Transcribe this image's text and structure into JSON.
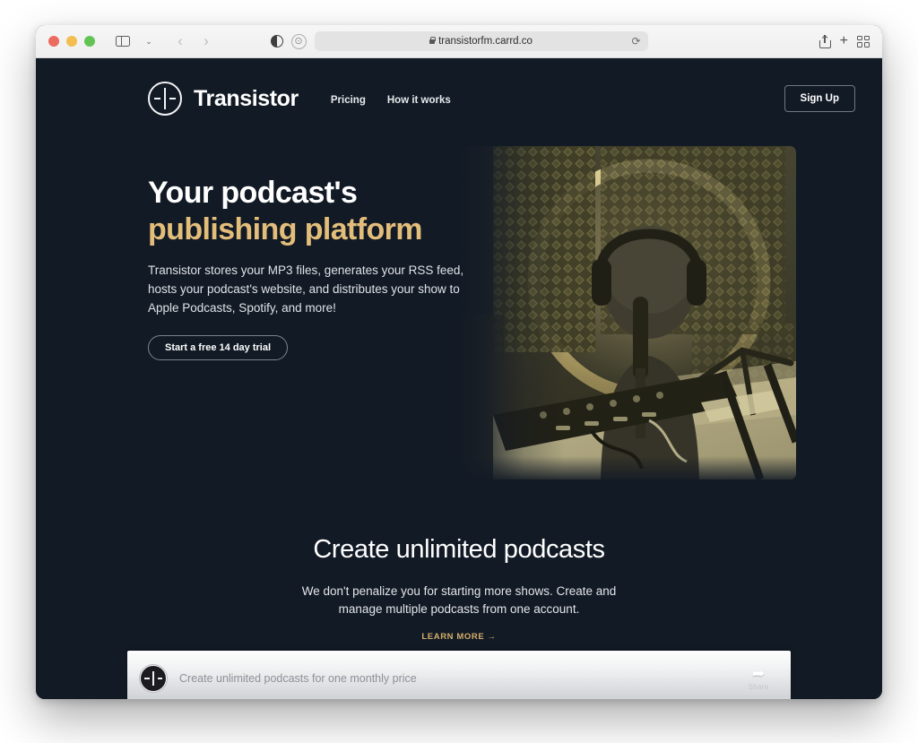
{
  "browser": {
    "name": "Safari",
    "traffic_lights": [
      "close",
      "minimize",
      "maximize"
    ],
    "sidebar_icon": "sidebar-icon",
    "sidebar_chevron": "⌄",
    "back_label": "‹",
    "forward_label": "›",
    "contrast_icon": "contrast-icon",
    "extension_icon": "⊙",
    "url": "transistorfm.carrd.co",
    "lock_icon": "lock-icon",
    "reload_label": "⟳",
    "share_icon": "share-icon",
    "new_tab_label": "+",
    "tab_overview_icon": "tab-grid-icon"
  },
  "site": {
    "brand": {
      "name": "Transistor",
      "logo_icon": "transistor-logo-icon"
    },
    "nav": [
      {
        "label": "Pricing"
      },
      {
        "label": "How it works"
      }
    ],
    "signup_label": "Sign Up",
    "hero": {
      "title_line_1": "Your podcast's",
      "title_line_2": "publishing platform",
      "accent_color": "#e3bd7a",
      "body": "Transistor stores your MP3 files, generates your RSS feed, hosts your podcast's website, and distributes your show to Apple Podcasts, Spotify, and more!",
      "cta_label": "Start a free 14 day trial",
      "image_alt": "Podcaster wearing headphones speaking into a studio microphone"
    },
    "feature": {
      "title": "Create unlimited podcasts",
      "body": "We don't penalize you for starting more shows. Create and manage multiple podcasts from one account.",
      "link_label": "LEARN MORE →",
      "link_color": "#d5ae6b"
    },
    "player": {
      "logo_icon": "transistor-logo-icon",
      "episode_title": "Create unlimited podcasts for one monthly price",
      "share_icon": "➦",
      "share_label": "Share"
    },
    "background_color": "#121a25"
  }
}
